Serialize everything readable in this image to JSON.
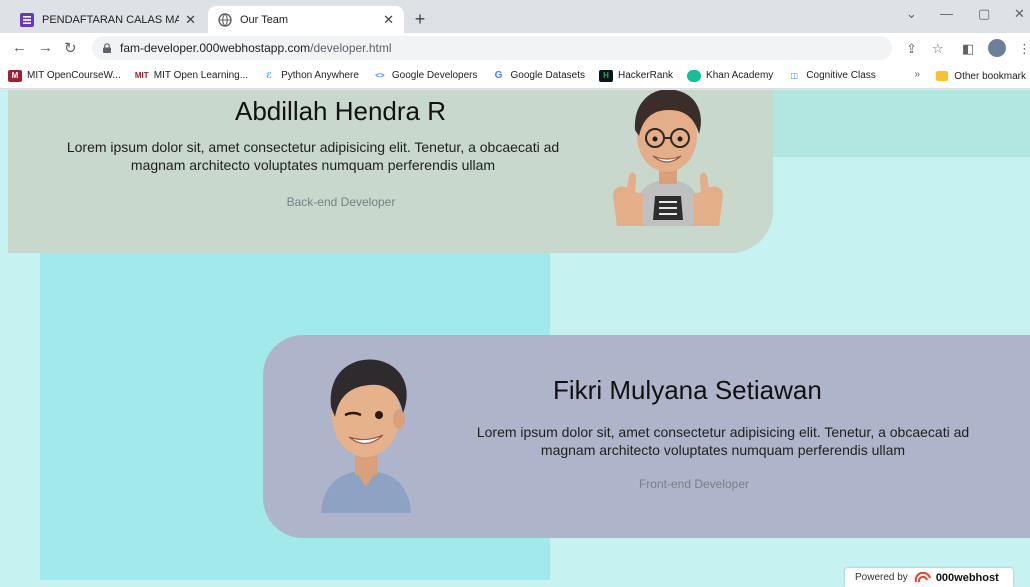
{
  "browser": {
    "tabs": [
      {
        "title": "PENDAFTARAN CALAS MATHDA",
        "active": false
      },
      {
        "title": "Our Team",
        "active": true
      }
    ],
    "new_tab": "+",
    "url_host": "fam-developer.000webhostapp.com",
    "url_path": "/developer.html",
    "bookmarks": [
      {
        "label": "MIT OpenCourseW...",
        "color": "#a31f34",
        "icon": "mit-ocw-icon"
      },
      {
        "label": "MIT Open Learning...",
        "color": "#a31f34",
        "icon": "mit-icon"
      },
      {
        "label": "Python Anywhere",
        "color": "#1d9fd6",
        "icon": "python-icon"
      },
      {
        "label": "Google Developers",
        "color": "#4285f4",
        "icon": "code-icon"
      },
      {
        "label": "Google Datasets",
        "color": "#4285f4",
        "icon": "google-icon"
      },
      {
        "label": "HackerRank",
        "color": "#1ba94c",
        "icon": "hackerrank-icon"
      },
      {
        "label": "Khan Academy",
        "color": "#14bf96",
        "icon": "khan-icon"
      },
      {
        "label": "Cognitive Class",
        "color": "#4a90d9",
        "icon": "cognitive-icon"
      }
    ],
    "more_bookmarks": "»",
    "other_bookmarks": "Other bookmark"
  },
  "page": {
    "members": [
      {
        "name": "Abdillah Hendra R",
        "description_line1": "Lorem ipsum dolor sit, amet consectetur adipisicing elit. Tenetur, a obcaecati ad",
        "description_line2": "magnam architecto voluptates numquam perferendis ullam",
        "role": "Back-end Developer"
      },
      {
        "name": "Fikri Mulyana Setiawan",
        "description_line1": "Lorem ipsum dolor sit, amet consectetur adipisicing elit. Tenetur, a obcaecati ad",
        "description_line2": "magnam architecto voluptates numquam perferendis ullam",
        "role": "Front-end Developer"
      }
    ],
    "powered_by": "Powered by",
    "powered_brand": "000webhost"
  },
  "colors": {
    "page_bg": "#c7f2f2",
    "card1_bg": "#c8d8cc",
    "card2_bg": "#aeb4c9",
    "accent_block": "#a2e9eb"
  }
}
